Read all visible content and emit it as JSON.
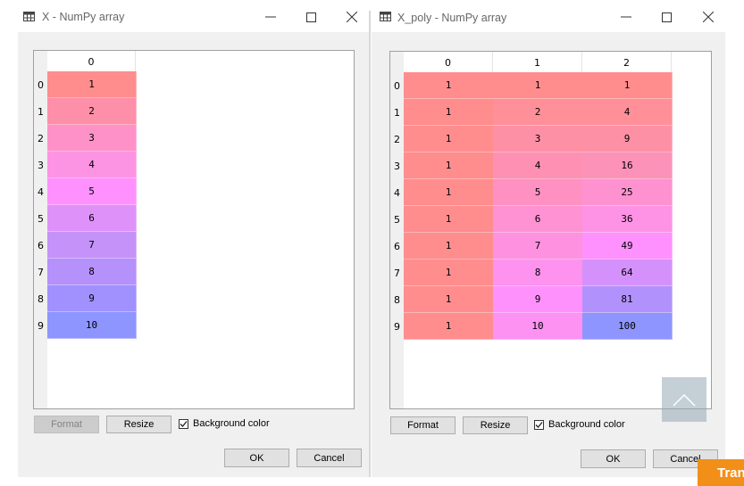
{
  "left": {
    "title": "X - NumPy array",
    "columns": [
      "0"
    ],
    "rows": [
      "0",
      "1",
      "2",
      "3",
      "4",
      "5",
      "6",
      "7",
      "8",
      "9"
    ],
    "cells": [
      [
        "1"
      ],
      [
        "2"
      ],
      [
        "3"
      ],
      [
        "4"
      ],
      [
        "5"
      ],
      [
        "6"
      ],
      [
        "7"
      ],
      [
        "8"
      ],
      [
        "9"
      ],
      [
        "10"
      ]
    ],
    "colors": [
      [
        "#ff8d8e"
      ],
      [
        "#fe8fa9"
      ],
      [
        "#fe92c8"
      ],
      [
        "#fd93e3"
      ],
      [
        "#ff91ff"
      ],
      [
        "#df91fa"
      ],
      [
        "#c492f8"
      ],
      [
        "#b591fc"
      ],
      [
        "#a191fe"
      ],
      [
        "#8f95ff"
      ]
    ],
    "format_label": "Format",
    "resize_label": "Resize",
    "bg_color_label": "Background color",
    "bg_color_checked": true,
    "ok_label": "OK",
    "cancel_label": "Cancel"
  },
  "right": {
    "title": "X_poly - NumPy array",
    "columns": [
      "0",
      "1",
      "2"
    ],
    "rows": [
      "0",
      "1",
      "2",
      "3",
      "4",
      "5",
      "6",
      "7",
      "8",
      "9"
    ],
    "cells": [
      [
        "1",
        "1",
        "1"
      ],
      [
        "1",
        "2",
        "4"
      ],
      [
        "1",
        "3",
        "9"
      ],
      [
        "1",
        "4",
        "16"
      ],
      [
        "1",
        "5",
        "25"
      ],
      [
        "1",
        "6",
        "36"
      ],
      [
        "1",
        "7",
        "49"
      ],
      [
        "1",
        "8",
        "64"
      ],
      [
        "1",
        "9",
        "81"
      ],
      [
        "1",
        "10",
        "100"
      ]
    ],
    "colors": [
      [
        "#ff8d8e",
        "#ff8d8e",
        "#ff8d8e"
      ],
      [
        "#ff8d8e",
        "#ff8f98",
        "#ff8f98"
      ],
      [
        "#ff8d8e",
        "#fe90a6",
        "#fe90a6"
      ],
      [
        "#ff8d8e",
        "#fe90b4",
        "#fd92b9"
      ],
      [
        "#ff8d8e",
        "#fe91c2",
        "#fe92d0"
      ],
      [
        "#ff8d8e",
        "#fe92d2",
        "#fe93e6"
      ],
      [
        "#ff8d8e",
        "#fe92e0",
        "#ff91ff"
      ],
      [
        "#ff8d8e",
        "#fe92ef",
        "#d591fb"
      ],
      [
        "#ff8d8e",
        "#ff91fd",
        "#b192fc"
      ],
      [
        "#ff8d8e",
        "#fd92f2",
        "#8f95ff"
      ]
    ],
    "format_label": "Format",
    "resize_label": "Resize",
    "bg_color_label": "Background color",
    "bg_color_checked": true,
    "ok_label": "OK",
    "cancel_label": "Cancel"
  },
  "overlay": {
    "scroll_top_icon": "chevron-up-icon",
    "banner_text": "Tran"
  },
  "icons": {
    "table": "table-icon",
    "minimize": "minimize-icon",
    "maximize": "maximize-icon",
    "close": "close-icon"
  }
}
